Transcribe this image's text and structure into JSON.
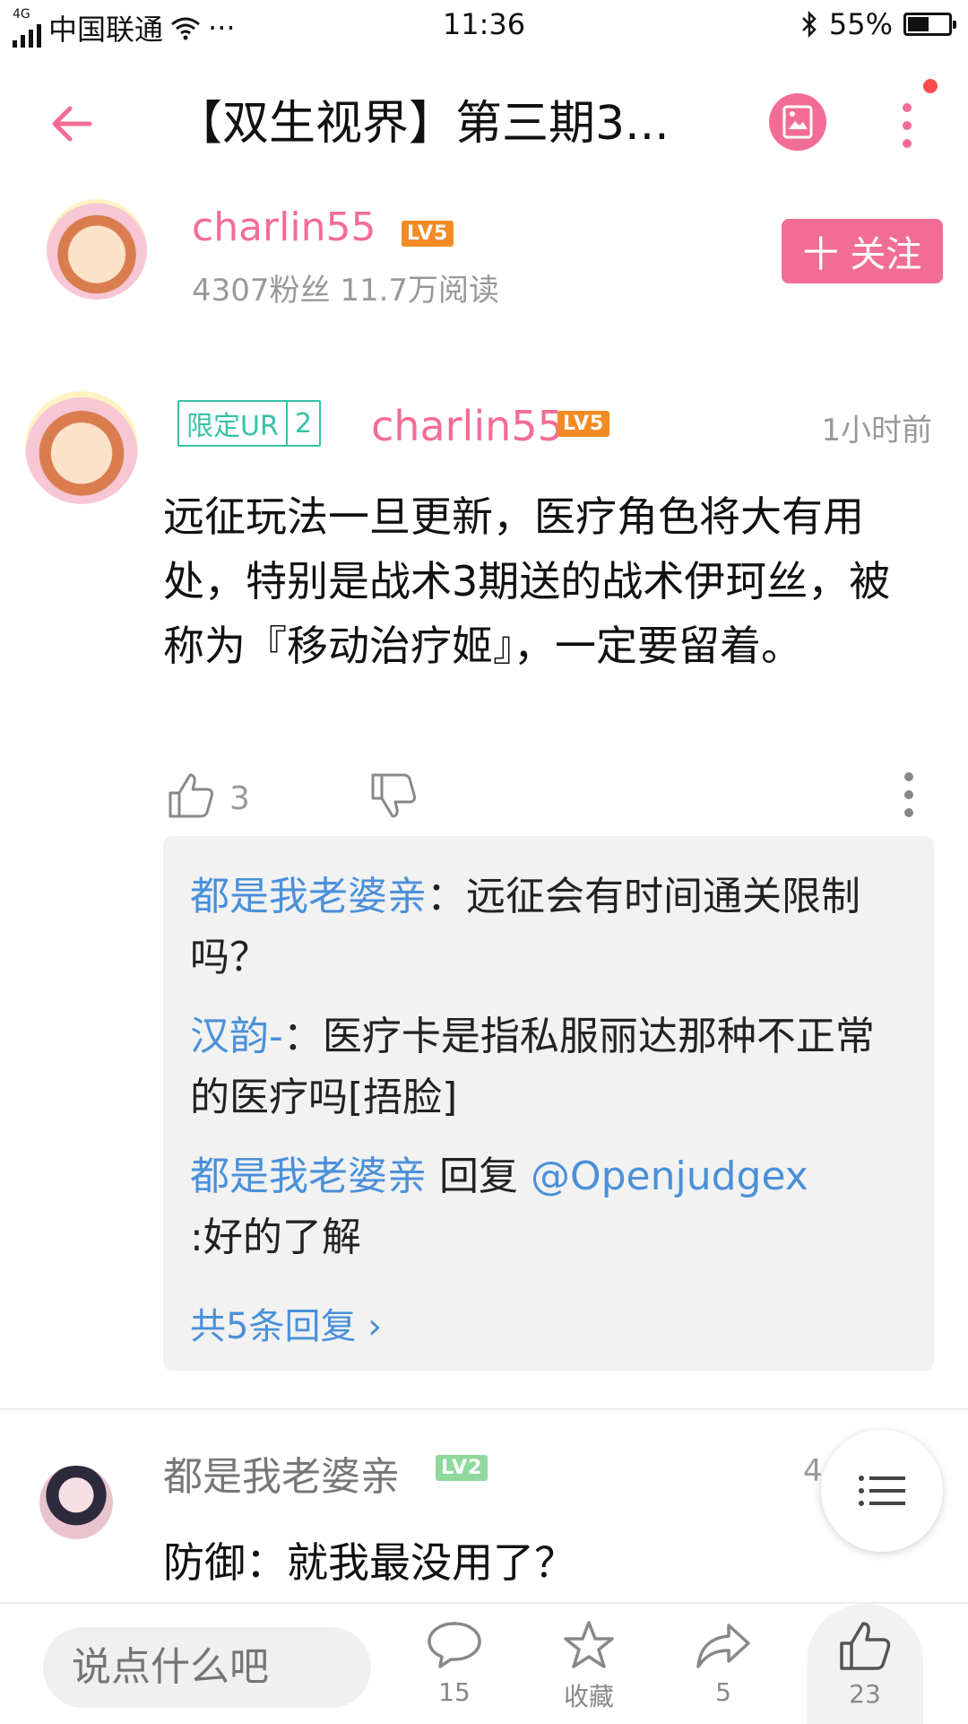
{
  "status_bar": {
    "network": "4G",
    "carrier": "中国联通",
    "more": "···",
    "time": "11:36",
    "battery_percent": "55%",
    "battery_level": 0.55
  },
  "nav": {
    "title": "【双生视界】第三期3...",
    "back_icon": "back-arrow-icon",
    "picture_icon": "picture-icon",
    "more_icon": "vertical-dots-icon"
  },
  "author": {
    "name": "charlin55",
    "level": "LV5",
    "stats": "4307粉丝  11.7万阅读",
    "follow_label": "十 关注"
  },
  "comment1": {
    "badge_left": "限定UR",
    "badge_right": "2",
    "name": "charlin55",
    "level": "LV5",
    "time": "1小时前",
    "text": "远征玩法一旦更新，医疗角色将大有用处，特别是战术3期送的战术伊珂丝，被称为『移动治疗姬』，一定要留着。",
    "likes": "3",
    "replies": [
      {
        "who": "都是我老婆亲",
        "text": "：远征会有时间通关限制吗？"
      },
      {
        "who": "汉韵-",
        "text": "：医疗卡是指私服丽达那种不正常的医疗吗[捂脸]"
      },
      {
        "who": "都是我老婆亲",
        "mid": " 回复 ",
        "mention": "@Openjudgex",
        "text": ":好的了解"
      }
    ],
    "more_replies": "共5条回复 ›"
  },
  "comment2": {
    "name": "都是我老婆亲",
    "level": "LV2",
    "time": "4 前",
    "text": "防御：就我最没用了？"
  },
  "bottom_bar": {
    "input_placeholder": "说点什么吧",
    "comments_count": "15",
    "favorite_label": "收藏",
    "shares_count": "5",
    "likes_count": "23"
  },
  "colors": {
    "accent_pink": "#f26d96",
    "link_blue": "#4a90d9",
    "badge_teal": "#36c2a6",
    "lv5_orange": "#f28b24",
    "lv2_green": "#8fd99d"
  }
}
